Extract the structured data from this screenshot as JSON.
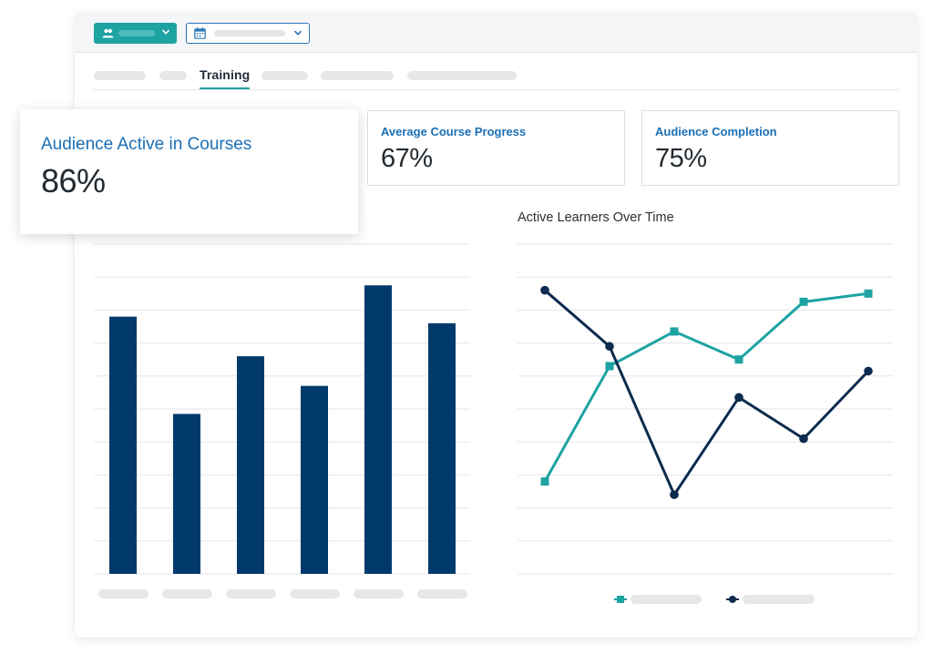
{
  "tabs": {
    "active_label": "Training"
  },
  "metrics": {
    "audience_active": {
      "label": "Audience Active in Courses",
      "value": "86%"
    },
    "avg_progress": {
      "label": "Average Course Progress",
      "value": "67%"
    },
    "completion": {
      "label": "Audience Completion",
      "value": "75%"
    }
  },
  "colors": {
    "bar": "#003a6c",
    "teal": "#1ea3a3",
    "navy": "#0d2b4e",
    "accent_blue": "#1a6fb5"
  },
  "icons": {
    "team": "people-icon",
    "date": "calendar-icon",
    "dropdown": "chevron-down-icon"
  },
  "chart_data": [
    {
      "type": "bar",
      "title": "",
      "categories": [
        "",
        "",
        "",
        "",
        "",
        ""
      ],
      "values": [
        7.8,
        4.85,
        6.6,
        5.7,
        8.75,
        7.6
      ],
      "ylim": [
        0,
        10
      ],
      "grid": true
    },
    {
      "type": "line",
      "title": "Active Learners Over Time",
      "x": [
        1,
        2,
        3,
        4,
        5,
        6
      ],
      "ylim": [
        0,
        10
      ],
      "grid": true,
      "legend": "bottom",
      "series": [
        {
          "marker": "square",
          "color": "#1ea3a3",
          "values": [
            2.8,
            6.3,
            7.35,
            6.5,
            8.25,
            8.5
          ]
        },
        {
          "marker": "circle",
          "color": "#0d2b4e",
          "values": [
            8.6,
            6.9,
            2.4,
            5.35,
            4.1,
            6.15
          ]
        }
      ]
    }
  ]
}
